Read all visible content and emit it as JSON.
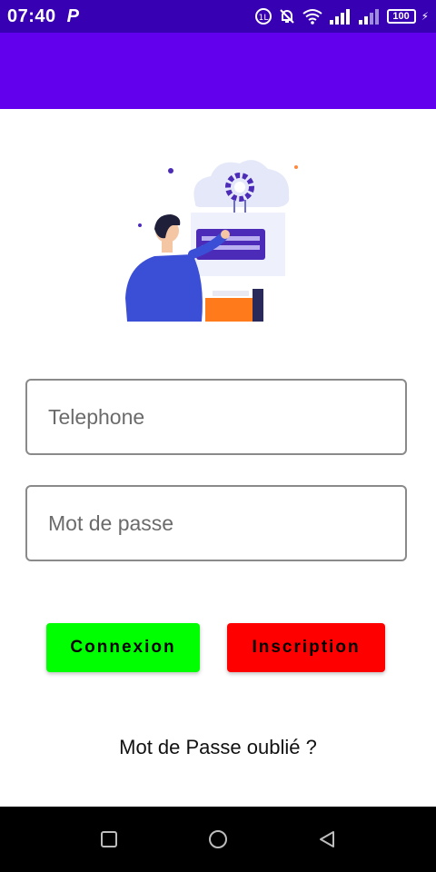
{
  "status_bar": {
    "time": "07:40",
    "app_icon": "P",
    "battery": "100",
    "icons": [
      "data-saver-icon",
      "mute-icon",
      "wifi-icon",
      "signal-icon",
      "signal-icon-2",
      "battery-icon",
      "charging-icon"
    ]
  },
  "colors": {
    "status_bar": "#3700b3",
    "app_bar": "#6200ee",
    "login_button": "#00ff00",
    "signup_button": "#ff0000",
    "nav_bar": "#000000"
  },
  "form": {
    "phone_placeholder": "Telephone",
    "password_placeholder": "Mot de passe",
    "login_label": "Connexion",
    "signup_label": "Inscription",
    "forgot_label": "Mot de Passe oublié ?"
  },
  "nav_bar": {
    "icons": [
      "recents-icon",
      "home-icon",
      "back-icon"
    ]
  }
}
